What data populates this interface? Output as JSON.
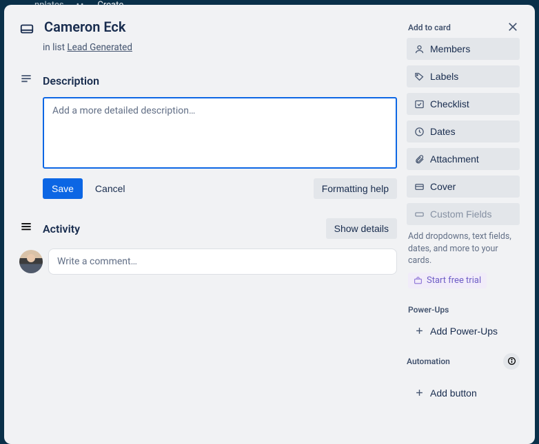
{
  "background": {
    "top_items": [
      "nplates",
      "••",
      "Create"
    ]
  },
  "card": {
    "title": "Cameron Eck",
    "in_list_prefix": "in list ",
    "list_name": "Lead Generated"
  },
  "description": {
    "heading": "Description",
    "placeholder": "Add a more detailed description…",
    "value": "",
    "save": "Save",
    "cancel": "Cancel",
    "formatting_help": "Formatting help"
  },
  "activity": {
    "heading": "Activity",
    "show_details": "Show details",
    "comment_placeholder": "Write a comment…"
  },
  "sidebar": {
    "add_to_card": "Add to card",
    "items": [
      {
        "icon": "user",
        "label": "Members"
      },
      {
        "icon": "tag",
        "label": "Labels"
      },
      {
        "icon": "check",
        "label": "Checklist"
      },
      {
        "icon": "clock",
        "label": "Dates"
      },
      {
        "icon": "paperclip",
        "label": "Attachment"
      },
      {
        "icon": "cover",
        "label": "Cover"
      },
      {
        "icon": "field",
        "label": "Custom Fields",
        "disabled": true
      }
    ],
    "helper_text": "Add dropdowns, text fields, dates, and more to your cards.",
    "trial": "Start free trial",
    "powerups_heading": "Power-Ups",
    "add_powerups": "Add Power-Ups",
    "automation_heading": "Automation",
    "add_button": "Add button"
  }
}
